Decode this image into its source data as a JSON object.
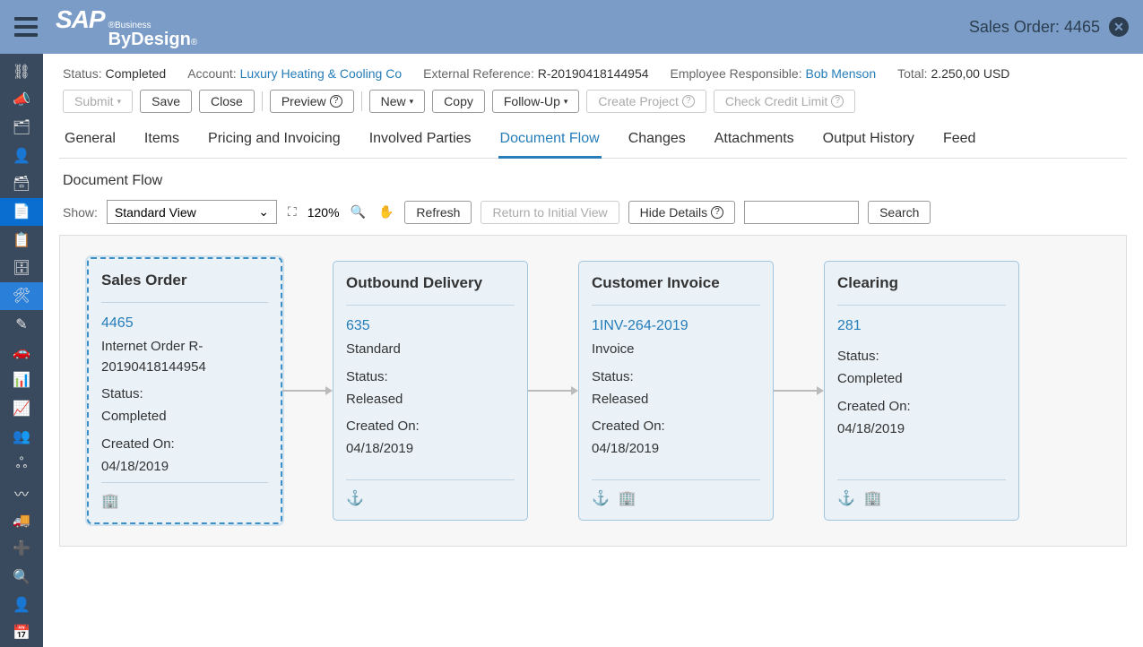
{
  "header": {
    "title": "Sales Order: 4465"
  },
  "info": {
    "status_label": "Status:",
    "status_value": "Completed",
    "account_label": "Account:",
    "account_value": "Luxury Heating & Cooling Co",
    "extref_label": "External Reference:",
    "extref_value": "R-20190418144954",
    "empresp_label": "Employee Responsible:",
    "empresp_value": "Bob Menson",
    "total_label": "Total:",
    "total_value": "2.250,00 USD"
  },
  "toolbar": {
    "submit": "Submit",
    "save": "Save",
    "close": "Close",
    "preview": "Preview",
    "new": "New",
    "copy": "Copy",
    "followup": "Follow-Up",
    "create_project": "Create Project",
    "check_credit": "Check Credit Limit"
  },
  "tabs": {
    "general": "General",
    "items": "Items",
    "pricing": "Pricing and Invoicing",
    "parties": "Involved Parties",
    "docflow": "Document Flow",
    "changes": "Changes",
    "attachments": "Attachments",
    "output": "Output History",
    "feed": "Feed"
  },
  "section_title": "Document Flow",
  "flow_toolbar": {
    "show_label": "Show:",
    "view": "Standard View",
    "zoom": "120%",
    "refresh": "Refresh",
    "return": "Return to Initial View",
    "hide_details": "Hide Details",
    "search": "Search"
  },
  "cards": [
    {
      "title": "Sales Order",
      "id": "4465",
      "desc": "Internet Order R-20190418144954",
      "status_label": "Status:",
      "status": "Completed",
      "created_label": "Created On:",
      "created": "04/18/2019",
      "icons": [
        "building"
      ]
    },
    {
      "title": "Outbound Delivery",
      "id": "635",
      "desc": "Standard",
      "status_label": "Status:",
      "status": "Released",
      "created_label": "Created On:",
      "created": "04/18/2019",
      "icons": [
        "anchor"
      ]
    },
    {
      "title": "Customer Invoice",
      "id": "1INV-264-2019",
      "desc": " Invoice",
      "status_label": "Status:",
      "status": "Released",
      "created_label": "Created On:",
      "created": "04/18/2019",
      "icons": [
        "anchor",
        "building"
      ]
    },
    {
      "title": "Clearing",
      "id": "281",
      "desc": "",
      "status_label": "Status:",
      "status": "Completed",
      "created_label": "Created On:",
      "created": "04/18/2019",
      "icons": [
        "anchor",
        "building"
      ]
    }
  ]
}
